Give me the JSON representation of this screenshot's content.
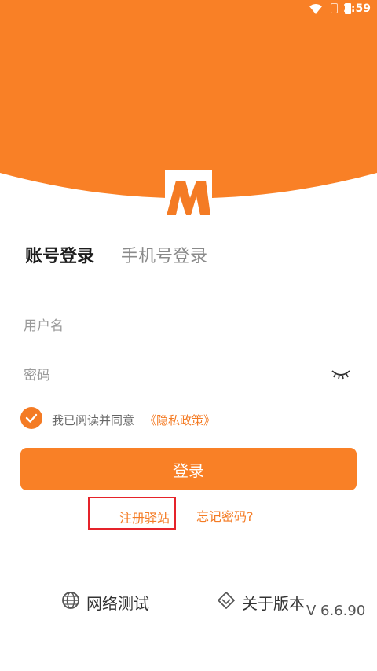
{
  "status_bar": {
    "time": "2:59"
  },
  "tabs": {
    "account": "账号登录",
    "phone": "手机号登录"
  },
  "form": {
    "username_placeholder": "用户名",
    "password_placeholder": "密码"
  },
  "agreement": {
    "text": "我已阅读并同意",
    "link": "《隐私政策》",
    "checked": true
  },
  "login_button": "登录",
  "links": {
    "register": "注册驿站",
    "forgot": "忘记密码?"
  },
  "bottom": {
    "network_test": "网络测试",
    "about_version": "关于版本",
    "version": "V 6.6.90"
  },
  "colors": {
    "accent": "#f47b24",
    "header": "#f98026",
    "highlight_box": "#e5232a"
  }
}
